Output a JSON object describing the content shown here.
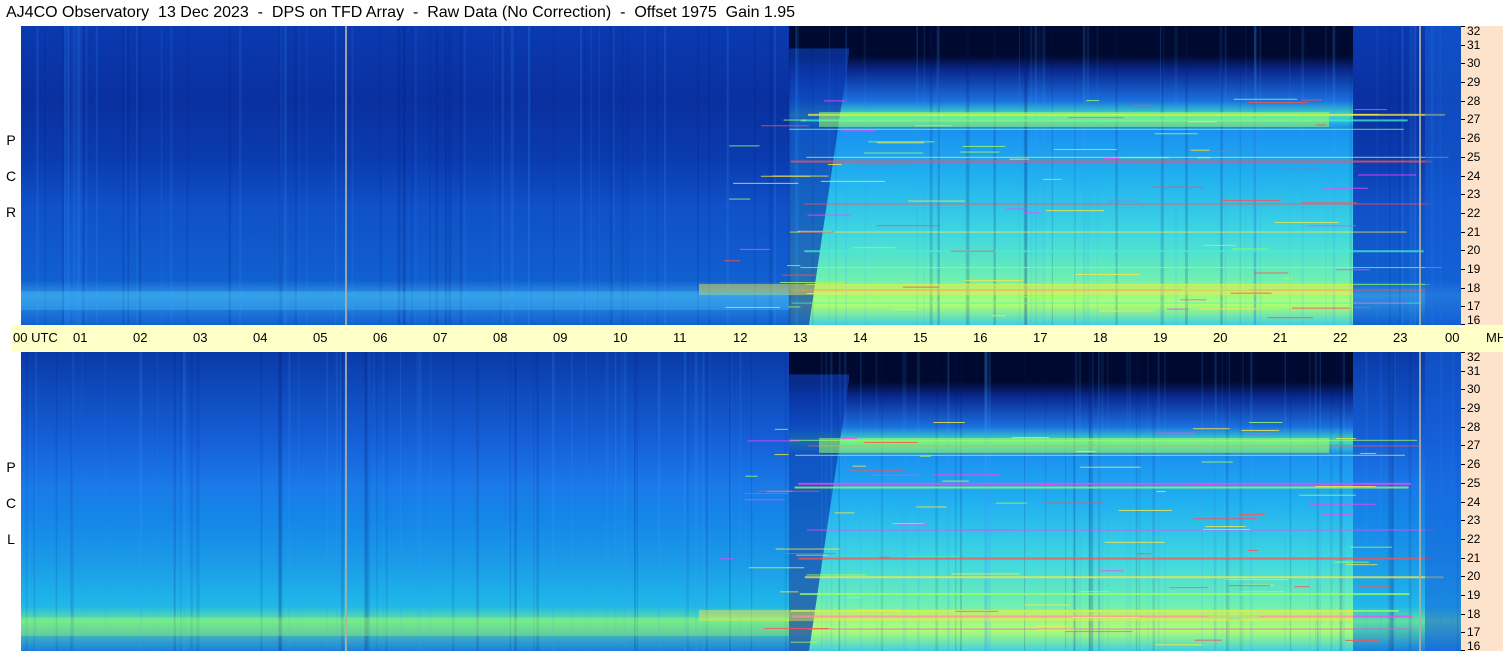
{
  "title": "AJ4CO Observatory  13 Dec 2023  -  DPS on TFD Array  -  Raw Data (No Correction)  -  Offset 1975  Gain 1.95",
  "chart_data": {
    "type": "heatmap",
    "title": "AJ4CO Observatory  13 Dec 2023  -  DPS on TFD Array  -  Raw Data (No Correction)  -  Offset 1975  Gain 1.95",
    "panels": [
      {
        "name": "RCP",
        "label_letters": [
          "R",
          "C",
          "P"
        ]
      },
      {
        "name": "LCP",
        "label_letters": [
          "L",
          "C",
          "P"
        ]
      }
    ],
    "x": {
      "label": "UTC",
      "range_hours": [
        0,
        24
      ],
      "tick_labels": [
        "00 UTC",
        "01",
        "02",
        "03",
        "04",
        "05",
        "06",
        "07",
        "08",
        "09",
        "10",
        "11",
        "12",
        "13",
        "14",
        "15",
        "16",
        "17",
        "18",
        "19",
        "20",
        "21",
        "22",
        "23",
        "00"
      ]
    },
    "y": {
      "unit": "MHz",
      "range_mhz": [
        16,
        32
      ],
      "tick_labels": [
        "16",
        "17",
        "18",
        "19",
        "20",
        "21",
        "22",
        "23",
        "24",
        "25",
        "26",
        "27",
        "28",
        "29",
        "30",
        "31",
        "32"
      ]
    },
    "colormap": [
      "#000a30",
      "#0020a0",
      "#0050e0",
      "#1a8cff",
      "#20c8ff",
      "#40f0d0",
      "#a0ff60",
      "#ffe840",
      "#ff5050",
      "#ff40ff"
    ],
    "daytime_hours_utc": [
      12.8,
      22.2
    ],
    "vertical_markers_hours_utc": [
      5.4,
      23.3
    ],
    "day_top_fade_mhz": [
      30.5,
      32
    ]
  }
}
